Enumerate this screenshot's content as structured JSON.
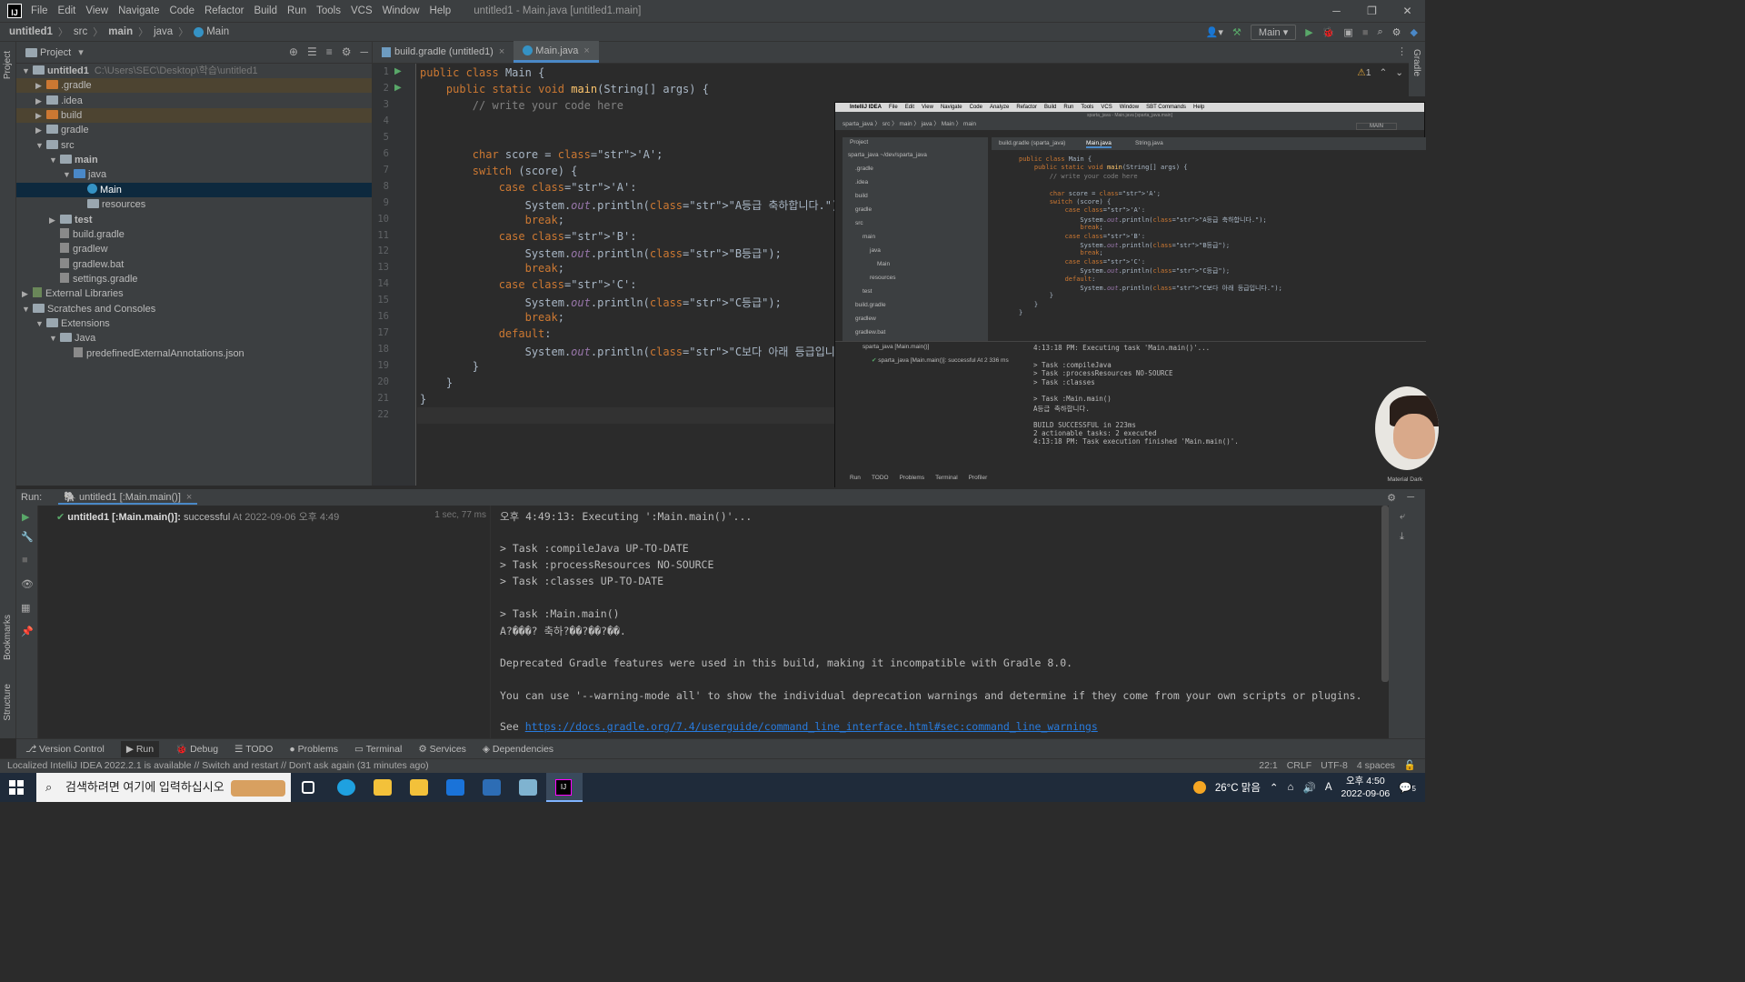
{
  "titlebar": {
    "menu": [
      "File",
      "Edit",
      "View",
      "Navigate",
      "Code",
      "Refactor",
      "Build",
      "Run",
      "Tools",
      "VCS",
      "Window",
      "Help"
    ],
    "title": "untitled1 - Main.java [untitled1.main]"
  },
  "navbar": {
    "crumbs": [
      "untitled1",
      "src",
      "main",
      "java",
      "Main"
    ],
    "run_config": "Main"
  },
  "left_strip": {
    "project": "Project",
    "bookmarks": "Bookmarks",
    "structure": "Structure"
  },
  "right_strip": {
    "gradle": "Gradle"
  },
  "project": {
    "title": "Project",
    "tree": [
      {
        "label": "untitled1",
        "path": "C:\\Users\\SEC\\Desktop\\학습\\untitled1",
        "depth": 0,
        "arrow": "down",
        "icon": "folder-grey",
        "bold": true
      },
      {
        "label": ".gradle",
        "depth": 1,
        "arrow": "right",
        "icon": "folder-orange",
        "hl": true
      },
      {
        "label": ".idea",
        "depth": 1,
        "arrow": "right",
        "icon": "folder-grey"
      },
      {
        "label": "build",
        "depth": 1,
        "arrow": "right",
        "icon": "folder-orange",
        "hl": true
      },
      {
        "label": "gradle",
        "depth": 1,
        "arrow": "right",
        "icon": "folder-grey"
      },
      {
        "label": "src",
        "depth": 1,
        "arrow": "down",
        "icon": "folder-grey"
      },
      {
        "label": "main",
        "depth": 2,
        "arrow": "down",
        "icon": "folder-grey",
        "bold": true
      },
      {
        "label": "java",
        "depth": 3,
        "arrow": "down",
        "icon": "folder-blue"
      },
      {
        "label": "Main",
        "depth": 4,
        "arrow": "",
        "icon": "class",
        "sel": true
      },
      {
        "label": "resources",
        "depth": 4,
        "arrow": "",
        "icon": "folder-grey"
      },
      {
        "label": "test",
        "depth": 2,
        "arrow": "right",
        "icon": "folder-grey",
        "bold": true
      },
      {
        "label": "build.gradle",
        "depth": 2,
        "arrow": "",
        "icon": "file"
      },
      {
        "label": "gradlew",
        "depth": 2,
        "arrow": "",
        "icon": "file"
      },
      {
        "label": "gradlew.bat",
        "depth": 2,
        "arrow": "",
        "icon": "file"
      },
      {
        "label": "settings.gradle",
        "depth": 2,
        "arrow": "",
        "icon": "file"
      },
      {
        "label": "External Libraries",
        "depth": 0,
        "arrow": "right",
        "icon": "library"
      },
      {
        "label": "Scratches and Consoles",
        "depth": 0,
        "arrow": "down",
        "icon": "folder-grey"
      },
      {
        "label": "Extensions",
        "depth": 1,
        "arrow": "down",
        "icon": "folder-grey"
      },
      {
        "label": "Java",
        "depth": 2,
        "arrow": "down",
        "icon": "folder-grey"
      },
      {
        "label": "predefinedExternalAnnotations.json",
        "depth": 3,
        "arrow": "",
        "icon": "file"
      }
    ]
  },
  "tabs": [
    {
      "label": "build.gradle (untitled1)",
      "active": false
    },
    {
      "label": "Main.java",
      "active": true
    }
  ],
  "editor": {
    "warning_count": "1",
    "lines": [
      "public class Main {",
      "    public static void main(String[] args) {",
      "        // write your code here",
      "",
      "",
      "        char score = 'A';",
      "        switch (score) {",
      "            case 'A':",
      "                System.out.println(\"A등급 축하합니다.\");",
      "                break;",
      "            case 'B':",
      "                System.out.println(\"B등급\");",
      "                break;",
      "            case 'C':",
      "                System.out.println(\"C등급\");",
      "                break;",
      "            default:",
      "                System.out.println(\"C보다 아래 등급입니다.\");",
      "        }",
      "    }",
      "}",
      ""
    ]
  },
  "overlay": {
    "menubar": [
      "IntelliJ IDEA",
      "File",
      "Edit",
      "View",
      "Navigate",
      "Code",
      "Analyze",
      "Refactor",
      "Build",
      "Run",
      "Tools",
      "VCS",
      "Window",
      "SBT Commands",
      "Help"
    ],
    "title": "sparta_java - Main.java [sparta_java.main]",
    "crumbs": "sparta_java 〉 src 〉 main 〉 java 〉 Main 〉 main",
    "run_config": "MAIN",
    "project_title": "Project",
    "tree": [
      "sparta_java  ~/dev/sparta_java",
      ".gradle",
      ".idea",
      "build",
      "gradle",
      "src",
      "main",
      "java",
      "Main",
      "resources",
      "test",
      "build.gradle",
      "gradlew",
      "gradlew.bat"
    ],
    "tabs": [
      "build.gradle (sparta_java)",
      "Main.java",
      "String.java"
    ],
    "code": [
      "public class Main {",
      "    public static void main(String[] args) {",
      "        // write your code here",
      "",
      "        char score = 'A';",
      "        switch (score) {",
      "            case 'A':",
      "                System.out.println(\"A등급 축하합니다.\");",
      "                break;",
      "            case 'B':",
      "                System.out.println(\"B등급\");",
      "                break;",
      "            case 'C':",
      "                System.out.println(\"C등급\");",
      "            default:",
      "                System.out.println(\"C보다 아래 등급입니다.\");",
      "        }",
      "    }",
      "}"
    ],
    "run_tab": "sparta_java [Main.main()]",
    "run_item": "sparta_java [Main.main()]: successful At 2 336 ms",
    "output": [
      "4:13:18 PM: Executing task 'Main.main()'...",
      "",
      "> Task :compileJava",
      "> Task :processResources NO-SOURCE",
      "> Task :classes",
      "",
      "> Task :Main.main()",
      "A등급 축하합니다.",
      "",
      "BUILD SUCCESSFUL in 223ms",
      "2 actionable tasks: 2 executed",
      "4:13:18 PM: Task execution finished 'Main.main()'."
    ],
    "bottom_tabs": [
      "Run",
      "TODO",
      "Problems",
      "Terminal",
      "Profiler"
    ],
    "theme": "Material Dark"
  },
  "run": {
    "label": "Run:",
    "tab": "untitled1 [:Main.main()]",
    "item_name": "untitled1 [:Main.main()]:",
    "item_status": "successful",
    "item_time": "At 2022-09-06 오후 4:49",
    "item_duration": "1 sec, 77 ms",
    "console": [
      "오후 4:49:13: Executing ':Main.main()'...",
      "",
      "> Task :compileJava UP-TO-DATE",
      "> Task :processResources NO-SOURCE",
      "> Task :classes UP-TO-DATE",
      "",
      "> Task :Main.main()",
      "A?���? 축하?��?��?��.",
      "",
      "Deprecated Gradle features were used in this build, making it incompatible with Gradle 8.0.",
      "",
      "You can use '--warning-mode all' to show the individual deprecation warnings and determine if they come from your own scripts or plugins.",
      ""
    ],
    "see_label": "See ",
    "see_link": "https://docs.gradle.org/7.4/userguide/command_line_interface.html#sec:command_line_warnings"
  },
  "toolwindows": [
    "Version Control",
    "Run",
    "Debug",
    "TODO",
    "Problems",
    "Terminal",
    "Services",
    "Dependencies"
  ],
  "status": {
    "message": "Localized IntelliJ IDEA 2022.2.1 is available // Switch and restart // Don't ask again (31 minutes ago)",
    "position": "22:1",
    "line_sep": "CRLF",
    "encoding": "UTF-8",
    "indent": "4 spaces"
  },
  "taskbar": {
    "search_placeholder": "검색하려면 여기에 입력하십시오",
    "weather": "26°C 맑음",
    "ime": "A",
    "time": "오후 4:50",
    "date": "2022-09-06",
    "notifications": "5"
  },
  "colors": {
    "accent": "#4a88c7",
    "keyword": "#cc7832",
    "string": "#6a8759",
    "link": "#287bde",
    "success": "#59a869"
  }
}
